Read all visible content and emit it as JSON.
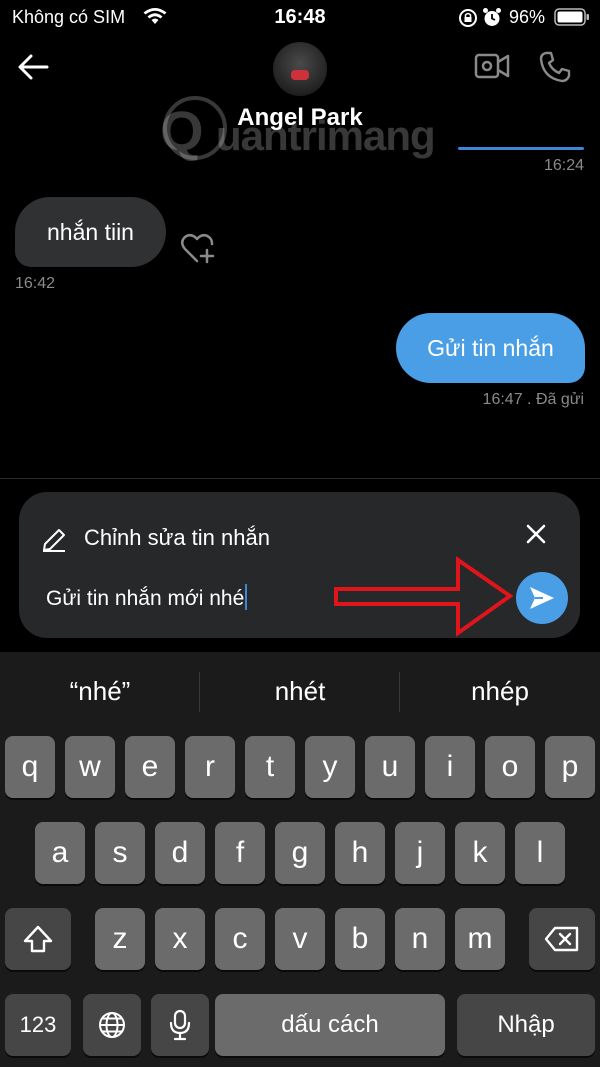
{
  "status_bar": {
    "carrier": "Không có SIM",
    "time": "16:48",
    "battery_percent": "96%"
  },
  "header": {
    "contact_name": "Angel Park",
    "watermark": "uantrimang"
  },
  "messages": [
    {
      "text": "",
      "time": "16:24",
      "direction": "out"
    },
    {
      "text": "nhắn tiin",
      "time": "16:42",
      "direction": "in"
    },
    {
      "text": "Gửi tin nhắn",
      "time": "16:47",
      "status": ". Đã gửi",
      "direction": "out"
    }
  ],
  "composer": {
    "edit_label": "Chỉnh sửa tin nhắn",
    "input_value": "Gửi tin nhắn mới nhé"
  },
  "keyboard": {
    "suggestions": [
      "“nhé”",
      "nhét",
      "nhép"
    ],
    "row1": [
      "q",
      "w",
      "e",
      "r",
      "t",
      "y",
      "u",
      "i",
      "o",
      "p"
    ],
    "row2": [
      "a",
      "s",
      "d",
      "f",
      "g",
      "h",
      "j",
      "k",
      "l"
    ],
    "row3": [
      "z",
      "x",
      "c",
      "v",
      "b",
      "n",
      "m"
    ],
    "numbers_key": "123",
    "space_key": "dấu cách",
    "return_key": "Nhập"
  },
  "colors": {
    "accent": "#4a9ee6",
    "incoming_bubble": "#2f3133",
    "arrow_annotation": "#e0151c"
  }
}
